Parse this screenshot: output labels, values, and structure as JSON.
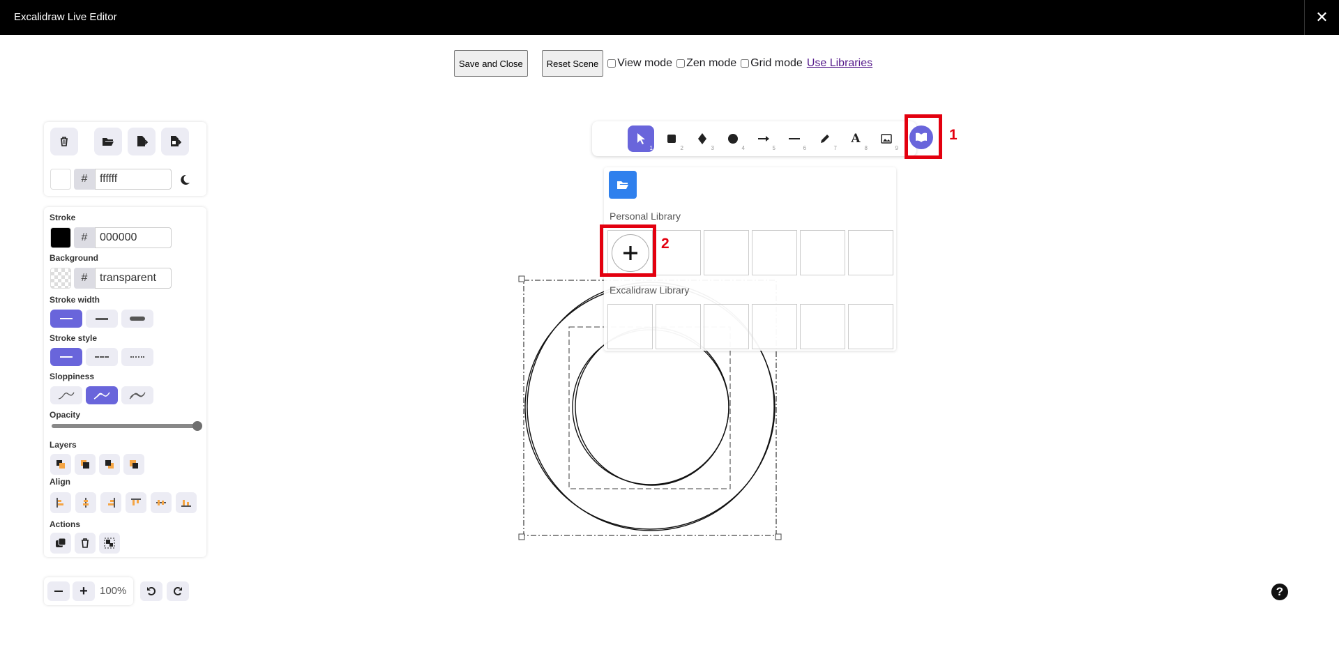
{
  "window": {
    "title": "Excalidraw Live Editor"
  },
  "topbar": {
    "save_close": "Save and Close",
    "reset_scene": "Reset Scene",
    "view_mode": "View mode",
    "zen_mode": "Zen mode",
    "grid_mode": "Grid mode",
    "use_libraries": "Use Libraries"
  },
  "canvas_panel": {
    "hash": "#",
    "bg_value": "ffffff"
  },
  "properties": {
    "stroke_label": "Stroke",
    "stroke_value": "000000",
    "background_label": "Background",
    "background_value": "transparent",
    "stroke_width_label": "Stroke width",
    "stroke_style_label": "Stroke style",
    "sloppiness_label": "Sloppiness",
    "opacity_label": "Opacity",
    "opacity_value": 100,
    "layers_label": "Layers",
    "align_label": "Align",
    "actions_label": "Actions"
  },
  "zoom": {
    "value": "100%"
  },
  "tools": [
    {
      "name": "selection",
      "key": "1"
    },
    {
      "name": "rectangle",
      "key": "2"
    },
    {
      "name": "diamond",
      "key": "3"
    },
    {
      "name": "ellipse",
      "key": "4"
    },
    {
      "name": "arrow",
      "key": "5"
    },
    {
      "name": "line",
      "key": "6"
    },
    {
      "name": "draw",
      "key": "7"
    },
    {
      "name": "text",
      "key": "8"
    },
    {
      "name": "image",
      "key": "9"
    }
  ],
  "library": {
    "personal_title": "Personal Library",
    "excalidraw_title": "Excalidraw Library"
  },
  "annotations": {
    "one": "1",
    "two": "2"
  },
  "colors": {
    "accent": "#6965db",
    "annotation": "#e3000f",
    "library_blue": "#2f80ed"
  }
}
